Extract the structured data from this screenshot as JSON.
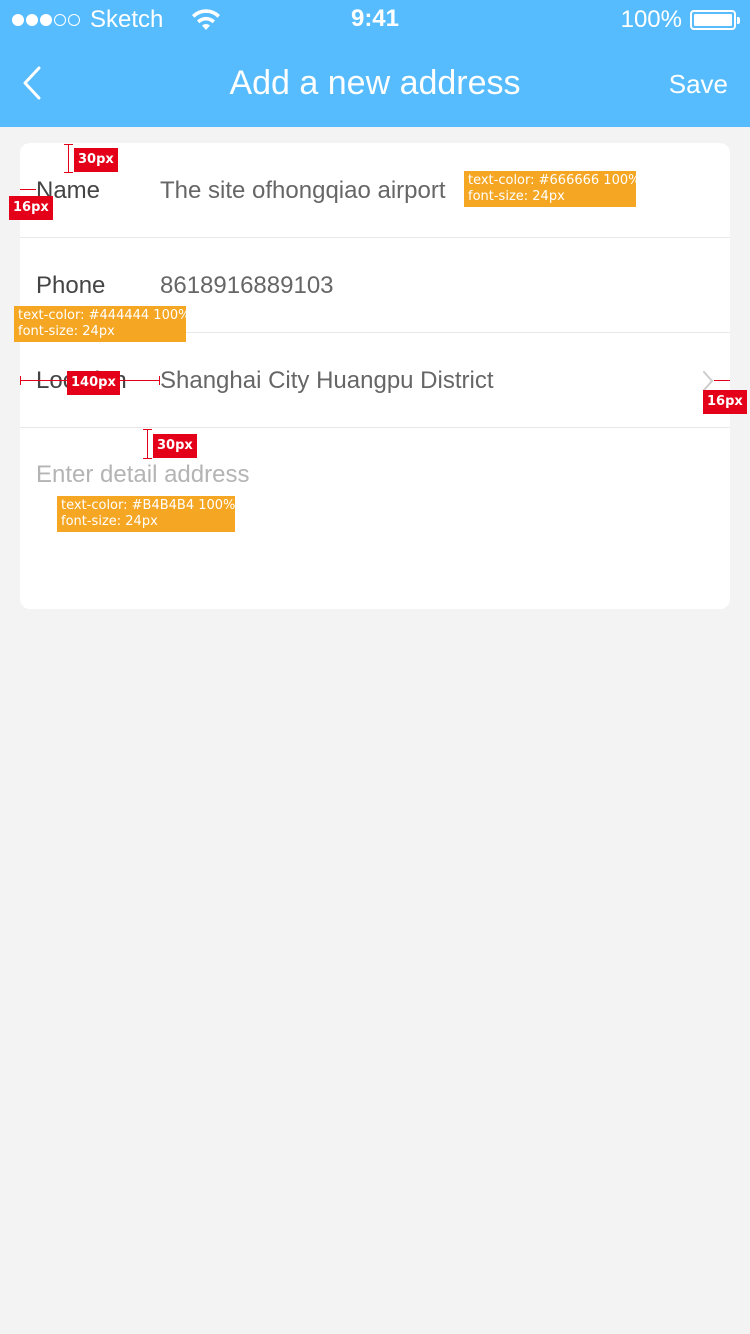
{
  "status_bar": {
    "carrier": "Sketch",
    "time": "9:41",
    "battery": "100%",
    "signal_bars_filled": 3,
    "signal_bars_total": 5
  },
  "nav": {
    "title": "Add a new address",
    "save_label": "Save",
    "back_icon": "chevron-left-icon"
  },
  "form": {
    "name": {
      "label": "Name",
      "value": "The site ofhongqiao airport"
    },
    "phone": {
      "label": "Phone",
      "value": "8618916889103"
    },
    "location": {
      "label": "Location",
      "value": "Shanghai City Huangpu District",
      "icon": "chevron-right-icon"
    },
    "detail": {
      "placeholder": "Enter detail address",
      "value": ""
    }
  },
  "annotations": {
    "value_style": {
      "line1": "text-color: #666666 100%",
      "line2": "font-size: 24px"
    },
    "label_style": {
      "line1": "text-color: #444444 100%",
      "line2": "font-size: 24px"
    },
    "placeholder_style": {
      "line1": "text-color: #B4B4B4 100%",
      "line2": "font-size: 24px"
    },
    "top_padding": "30px",
    "left_padding": "16px",
    "label_width": "140px",
    "right_padding": "16px",
    "detail_top_padding": "30px"
  },
  "colors": {
    "header_bg": "#56bcfd",
    "page_bg": "#f3f3f3",
    "card_bg": "#ffffff",
    "label_text": "#444444",
    "value_text": "#666666",
    "placeholder_text": "#B4B4B4",
    "annotation_red": "#e30018",
    "annotation_orange": "#f5a623"
  }
}
